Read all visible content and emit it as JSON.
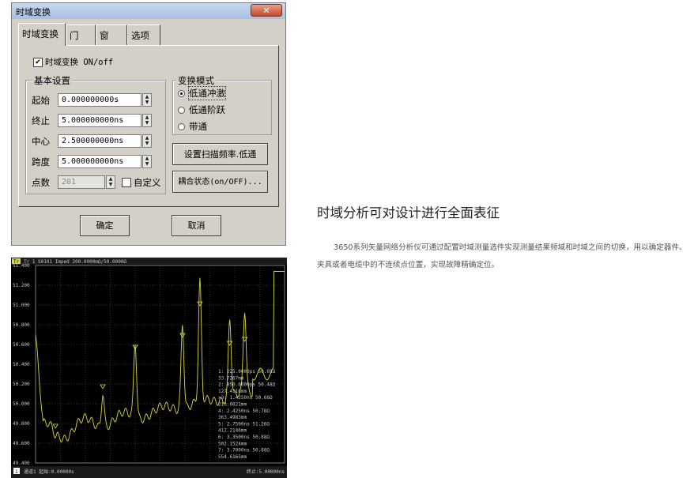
{
  "dialog": {
    "title": "时域变换",
    "close_glyph": "✕",
    "tabs": [
      {
        "label": "时域变换"
      },
      {
        "label": "门"
      },
      {
        "label": "窗"
      },
      {
        "label": "选项"
      }
    ],
    "enable_checkbox": {
      "label": "时域变换 ON/off",
      "checked": true
    },
    "basic_settings": {
      "title": "基本设置",
      "start": {
        "label": "起始",
        "value": "0.000000000s"
      },
      "stop": {
        "label": "终止",
        "value": "5.000000000ns"
      },
      "center": {
        "label": "中心",
        "value": "2.500000000ns"
      },
      "span": {
        "label": "跨度",
        "value": "5.000000000ns"
      },
      "points": {
        "label": "点数",
        "value": "201"
      },
      "custom_checkbox": {
        "label": "自定义",
        "checked": false
      }
    },
    "transform_mode": {
      "title": "变换模式",
      "options": [
        {
          "label": "低通冲激",
          "selected": true
        },
        {
          "label": "低通阶跃",
          "selected": false
        },
        {
          "label": "带通",
          "selected": false
        }
      ]
    },
    "set_freq_button": "设置扫描频率.低通",
    "coupling_button": "耦合状态(on/OFF)...",
    "ok_button": "确定",
    "cancel_button": "取消"
  },
  "scope": {
    "header": "Tr 1 S0101 Imped 200.0000mΩ/50.0000Ω",
    "footer_left": "通道1 起始:0.00000s",
    "footer_right": "终止:5.00000ns",
    "y_ticks": [
      "51.400",
      "51.200",
      "51.000",
      "50.800",
      "50.600",
      "50.400",
      "50.200",
      "50.000",
      "49.800",
      "49.600",
      "49.400"
    ],
    "markers": [
      {
        "text": "1:   225.0000ps  50.05Ω"
      },
      {
        "text": "        33.7267mm"
      },
      {
        "text": "2:   850.0000ps  50.48Ω"
      },
      {
        "text": "       127.4118mm"
      },
      {
        "text": ">3:    1.4250ns  50.66Ω"
      },
      {
        "text": "       213.6021mm"
      },
      {
        "text": "4:     2.4250ns  50.78Ω"
      },
      {
        "text": "       363.4983mm"
      },
      {
        "text": "5:     2.7500ns  51.26Ω"
      },
      {
        "text": "       412.2146mm"
      },
      {
        "text": "6:     3.3500ns  50.88Ω"
      },
      {
        "text": "       502.1524mm"
      },
      {
        "text": "7:     3.7000ns  50.88Ω"
      },
      {
        "text": "       554.6165mm"
      }
    ],
    "trace_color": "#d8d840"
  },
  "article": {
    "heading": "时域分析可对设计进行全面表征",
    "paragraph": "3650系列矢量网络分析仪可通过配置时域测量选件实现测量结果频域和时域之间的切换，用以确定器件、夹具或者电缆中的不连续点位置，实现故障精确定位。"
  }
}
